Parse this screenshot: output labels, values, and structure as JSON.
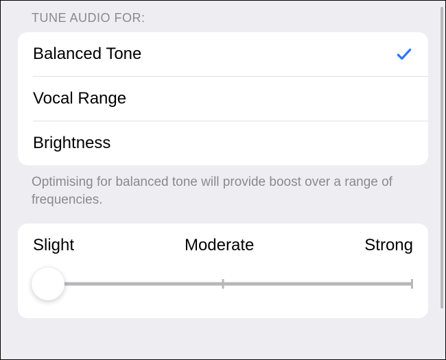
{
  "section": {
    "header": "TUNE AUDIO FOR:",
    "options": [
      {
        "label": "Balanced Tone",
        "selected": true
      },
      {
        "label": "Vocal Range",
        "selected": false
      },
      {
        "label": "Brightness",
        "selected": false
      }
    ],
    "footer": "Optimising for balanced tone will provide boost over a range of frequencies."
  },
  "slider": {
    "labels": {
      "min": "Slight",
      "mid": "Moderate",
      "max": "Strong"
    },
    "value": 0
  }
}
